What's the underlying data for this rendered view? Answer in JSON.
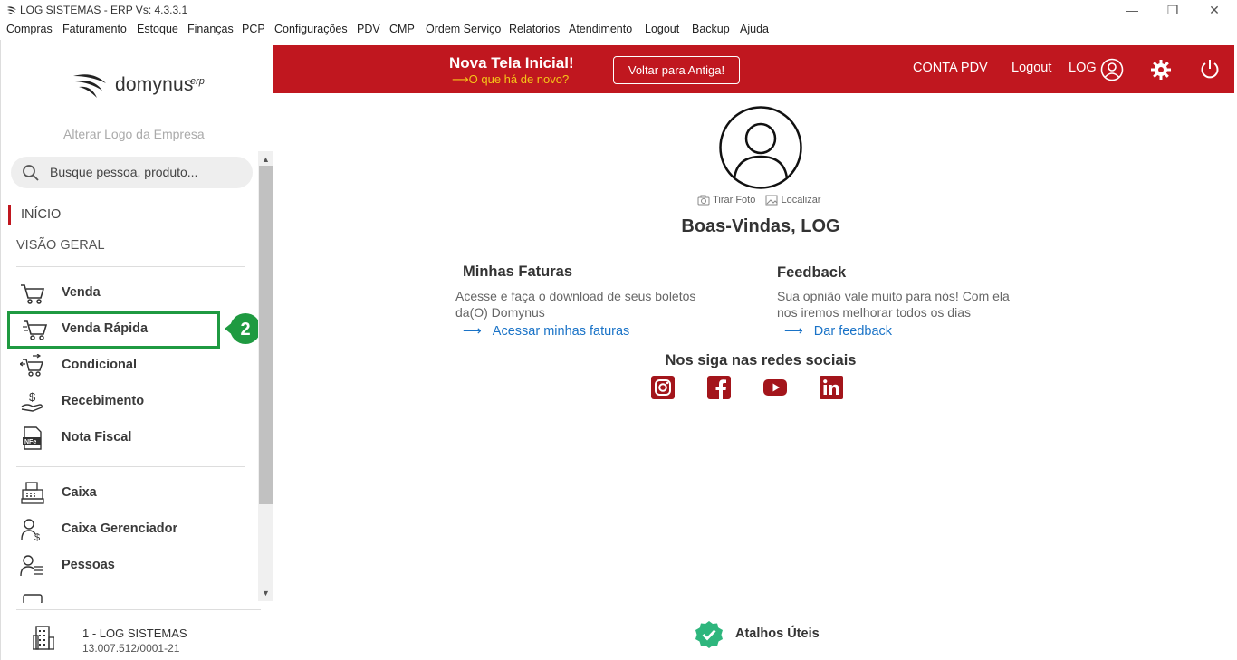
{
  "window": {
    "title": "LOG SISTEMAS - ERP Vs: 4.3.3.1",
    "minimize": "—",
    "maximize": "❐",
    "close": "✕"
  },
  "menu": [
    "Compras",
    "Faturamento",
    "Estoque",
    "Finanças",
    "PCP",
    "Configurações",
    "PDV",
    "CMP",
    "Ordem Serviço",
    "Relatorios",
    "Atendimento",
    "Logout",
    "Backup",
    "Ajuda"
  ],
  "sidebar": {
    "logo": {
      "text": "domynus",
      "sup": "erp"
    },
    "alter_logo": "Alterar Logo da Empresa",
    "search_placeholder": "Busque pessoa, produto...",
    "inicio": "INÍCIO",
    "visao_geral": "VISÃO GERAL",
    "items": [
      {
        "label": "Venda",
        "icon": "cart-icon"
      },
      {
        "label": "Venda Rápida",
        "icon": "cart-fast-icon"
      },
      {
        "label": "Condicional",
        "icon": "cart-arrows-icon"
      },
      {
        "label": "Recebimento",
        "icon": "money-hand-icon"
      },
      {
        "label": "Nota Fiscal",
        "icon": "nfe-icon"
      },
      {
        "label": "Caixa",
        "icon": "cash-register-icon"
      },
      {
        "label": "Caixa Gerenciador",
        "icon": "user-money-icon"
      },
      {
        "label": "Pessoas",
        "icon": "people-list-icon"
      }
    ],
    "badge": "2",
    "company_name": "1 - LOG SISTEMAS",
    "company_cnpj": "13.007.512/0001-21"
  },
  "topbar": {
    "title": "Nova Tela Inicial!",
    "subtitle": "⟶O que há de novo?",
    "back_button": "Voltar para Antiga!",
    "conta_pdv": "CONTA PDV",
    "logout": "Logout",
    "user": "LOG"
  },
  "profile": {
    "take_photo": "Tirar Foto",
    "locate": "Localizar",
    "welcome": "Boas-Vindas, LOG"
  },
  "cards": {
    "faturas": {
      "title": "Minhas Faturas",
      "desc": "Acesse e faça o download de seus boletos da(O) Domynus",
      "link": "Acessar minhas faturas"
    },
    "feedback": {
      "title": "Feedback",
      "desc": "Sua opnião vale muito para nós! Com ela nos iremos melhorar todos os dias",
      "link": "Dar feedback"
    }
  },
  "social": {
    "title": "Nos siga nas redes sociais",
    "networks": [
      "instagram-icon",
      "facebook-icon",
      "youtube-icon",
      "linkedin-icon"
    ]
  },
  "atalhos": "Atalhos Úteis",
  "colors": {
    "brand_red": "#c0171f",
    "highlight_green": "#1f9a41",
    "link_blue": "#1a73c7",
    "social_red": "#a3151b"
  }
}
